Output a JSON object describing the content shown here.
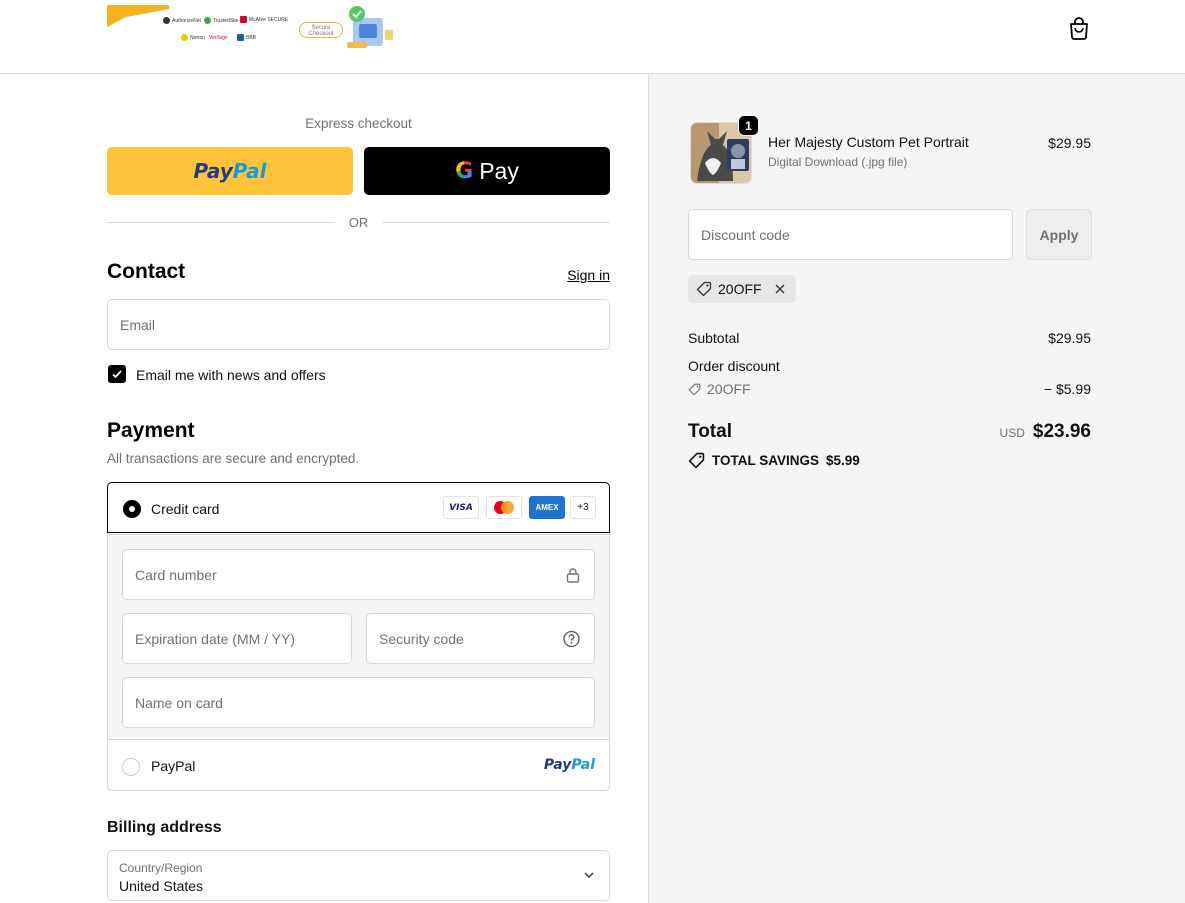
{
  "header": {
    "badges": [
      "AuthorizeNet",
      "TrustedSite",
      "McAfee SECURE",
      "Norton",
      "VeriSign",
      "BBB"
    ],
    "secure_badge": "Secure Checkout",
    "cart_icon": "shopping-bag-icon"
  },
  "express": {
    "title": "Express checkout",
    "paypal_part1": "Pay",
    "paypal_part2": "Pal",
    "gpay_g": "G",
    "gpay_label": "Pay",
    "or": "OR"
  },
  "contact": {
    "title": "Contact",
    "signin": "Sign in",
    "email_placeholder": "Email",
    "newsletter_label": "Email me with news and offers",
    "newsletter_checked": true
  },
  "payment": {
    "title": "Payment",
    "subtitle": "All transactions are secure and encrypted.",
    "credit_card_label": "Credit card",
    "card_brands": [
      "VISA",
      "Mastercard",
      "AMEX",
      "+3"
    ],
    "card_number_placeholder": "Card number",
    "expiration_placeholder": "Expiration date (MM / YY)",
    "security_placeholder": "Security code",
    "name_placeholder": "Name on card",
    "paypal_label": "PayPal",
    "paypal_logo_1": "Pay",
    "paypal_logo_2": "Pal"
  },
  "billing": {
    "title": "Billing address",
    "country_label": "Country/Region",
    "country_value": "United States"
  },
  "summary": {
    "product_name": "Her Majesty Custom Pet Portrait",
    "product_variant": "Digital Download (.jpg file)",
    "product_price": "$29.95",
    "quantity": "1",
    "discount_placeholder": "Discount code",
    "apply_label": "Apply",
    "applied_code": "20OFF",
    "subtotal_label": "Subtotal",
    "subtotal_value": "$29.95",
    "order_discount_label": "Order discount",
    "discount_code": "20OFF",
    "discount_value": "− $5.99",
    "total_label": "Total",
    "currency": "USD",
    "total_value": "$23.96",
    "savings_label": "TOTAL SAVINGS",
    "savings_value": "$5.99"
  },
  "colors": {
    "paypal_yellow": "#ffc439",
    "paypal_dark_blue": "#253b80",
    "paypal_light_blue": "#179bd7",
    "summary_bg": "#f5f5f5",
    "logo_accent": "#f6b21d"
  }
}
